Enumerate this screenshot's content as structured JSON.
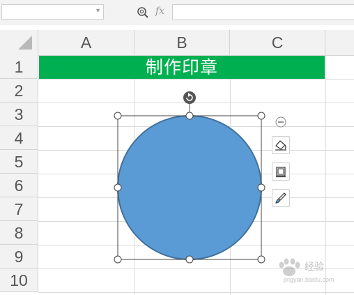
{
  "formula_bar": {
    "name_box_value": "",
    "fx_label": "fx",
    "formula_value": ""
  },
  "columns": [
    "A",
    "B",
    "C"
  ],
  "rows": [
    "1",
    "2",
    "3",
    "4",
    "5",
    "6",
    "7",
    "8",
    "9",
    "10"
  ],
  "cells": {
    "title": "制作印章"
  },
  "colors": {
    "title_fill": "#00b050",
    "circle_fill": "#5b9bd5",
    "circle_stroke": "#41719c"
  },
  "watermark": {
    "line1": "经验",
    "line2": "jingyan.baidu.com"
  },
  "icons": [
    "zoom-icon",
    "fx-icon",
    "collapse-icon",
    "shape-style-icon",
    "shape-outline-icon",
    "format-brush-icon",
    "rotate-handle-icon"
  ]
}
